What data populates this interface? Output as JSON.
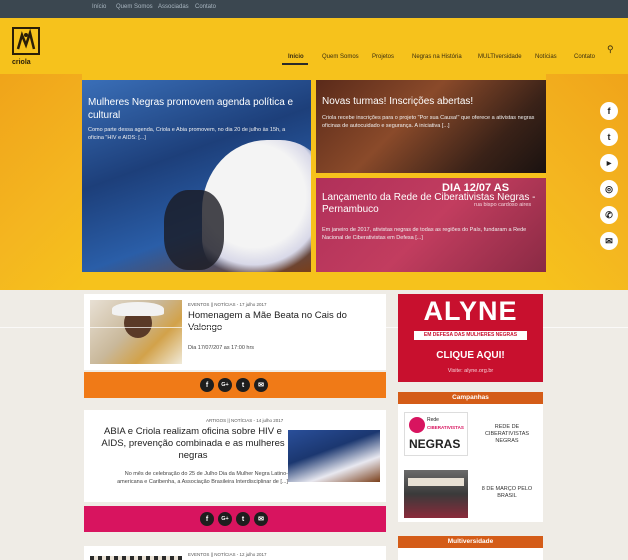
{
  "topbar": {
    "links": [
      "Início",
      "Quem Somos",
      "Associadas",
      "Contato"
    ]
  },
  "header": {
    "logo_text": "criola",
    "nav": [
      "Início",
      "Quem Somos",
      "Projetos",
      "Negras na História",
      "MULTIversidade",
      "Notícias",
      "Contato"
    ],
    "active_nav": "Início"
  },
  "hero": {
    "main": {
      "title": "Mulheres Negras promovem agenda política e cultural",
      "excerpt": "Como parte dessa agenda, Criola e Abia promovem, no dia 20 de julho às 15h, a oficina \"HIV e AIDS: [...]"
    },
    "top_right": {
      "title": "Novas turmas! Inscrições abertas!",
      "excerpt": "Criola recebe inscrições para o projeto \"Por sua Causa!\" que oferece a ativistas negras oficinas de autocuidado e segurança. A iniciativa [...]"
    },
    "bottom_right": {
      "title": "Lançamento da Rede de Ciberativistas Negras - Pernambuco",
      "excerpt": "Em janeiro de 2017, ativistas negras de todas as regiões do País, fundaram a Rede Nacional de Ciberativistas em Defesa [...]",
      "overlay_date": "DIA 12/07 AS",
      "overlay_sub": "rua bispo cardoso aires"
    }
  },
  "social_icons": [
    "facebook-icon",
    "twitter-icon",
    "youtube-icon",
    "instagram-icon",
    "whatsapp-icon",
    "email-icon"
  ],
  "posts": [
    {
      "meta": "EVENTOS || NOTÍCIAS - 17 julho 2017",
      "title": "Homenagem a Mãe Beata no Cais do Valongo",
      "body": "Dia 17/07/207 as 17:00 hrs",
      "share_color": "#f07a17"
    },
    {
      "meta": "ARTIGOS || NOTÍCIAS - 14 julho 2017",
      "title": "ABIA e Criola realizam oficina sobre HIV e AIDS, prevenção combinada e as mulheres negras",
      "body": "No mês de celebração do 25 de Julho Dia da Mulher Negra Latino-americana e Caribenha, a Associação Brasileira Interdisciplinar de [...]",
      "share_color": "#d8145f"
    },
    {
      "meta": "EVENTOS || NOTÍCIAS - 12 julho 2017"
    }
  ],
  "share_icons": [
    "f",
    "G+",
    "t",
    "✉"
  ],
  "sidebar": {
    "banner": {
      "title": "ALYNE",
      "subtitle": "EM DEFESA DAS MULHERES NEGRAS",
      "cta": "CLIQUE AQUI!",
      "visit": "Visite: alyne.org.br"
    },
    "campanhas_title": "Campanhas",
    "campanhas": [
      {
        "logo_top": "Rede",
        "logo_mid": "CIBERATIVISTAS",
        "logo_big": "NEGRAS",
        "label": "REDE DE CIBERATIVISTAS NEGRAS"
      },
      {
        "label": "8 DE MARÇO PELO BRASIL"
      }
    ],
    "multiversidade_title": "Multiversidade"
  },
  "colors": {
    "accent_yellow": "#f6c21c",
    "accent_orange": "#f07a17",
    "magenta": "#d8145f",
    "alyne_red": "#c8102e"
  }
}
